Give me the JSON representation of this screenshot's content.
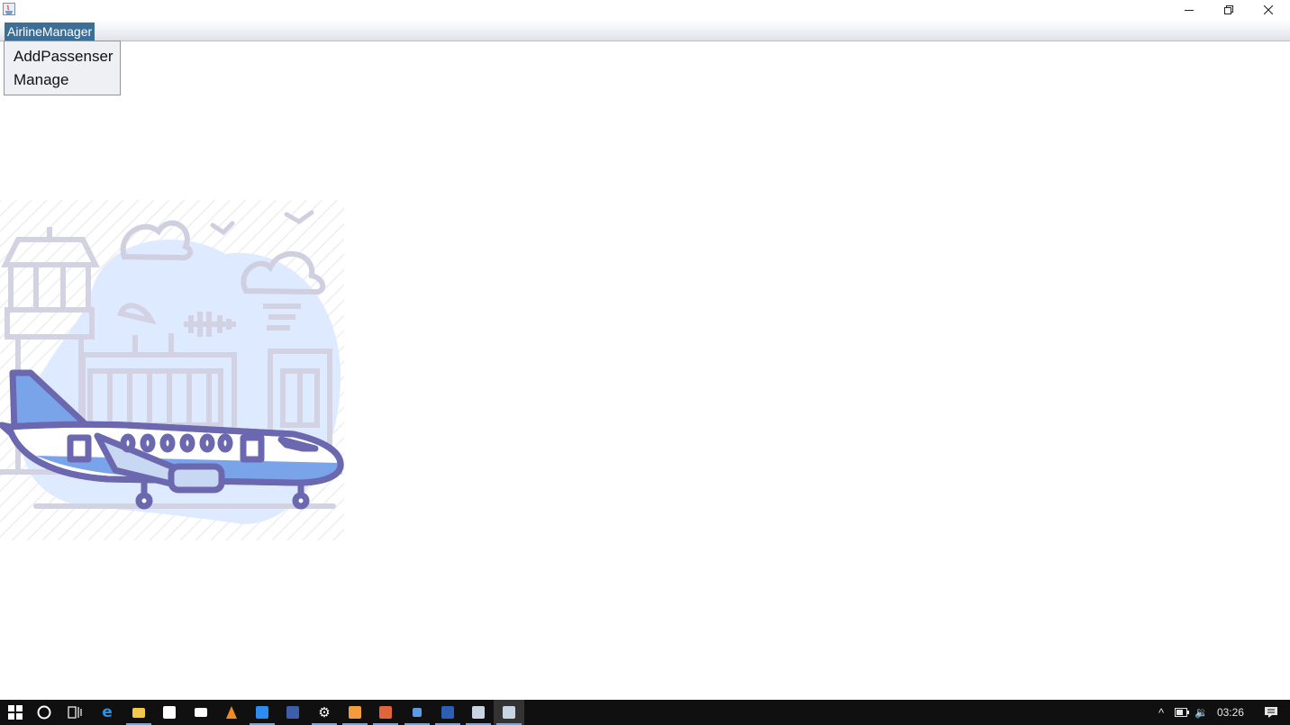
{
  "menubar": {
    "menu_label": "AirlineManager"
  },
  "popup_menu": {
    "items": [
      {
        "label": "AddPassenser"
      },
      {
        "label": "Manage"
      }
    ]
  },
  "taskbar": {
    "clock": "03:26",
    "tray_chevron": "^",
    "volume_symbol": "🔉"
  },
  "colors": {
    "menu_highlight": "#3d6e96",
    "popup_bg": "#eef0f4",
    "plane_outline": "#6b68b0",
    "plane_fill": "#7aa4ea",
    "sky_blob": "#deeaff",
    "taskbar_bg": "#101010"
  },
  "icons": {
    "app": "java-app-icon",
    "minimize": "minimize-icon",
    "restore": "restore-icon",
    "close": "close-icon",
    "illustration": "airport-airplane-illustration"
  }
}
